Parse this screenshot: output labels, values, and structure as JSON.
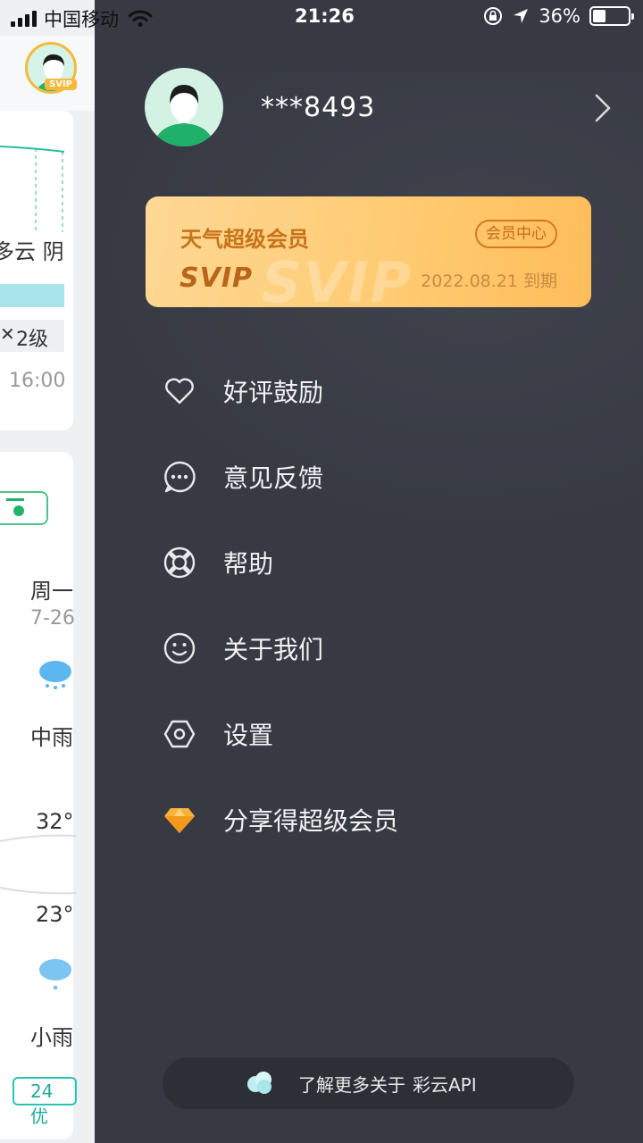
{
  "status_bar": {
    "carrier": "中国移动",
    "time": "21:26",
    "battery": "36%",
    "battery_level": 0.36
  },
  "background_app": {
    "weather_text": "多云 阴",
    "wind": "2级",
    "time_label": "16:00",
    "day_label": "周一",
    "date_label": "7-26",
    "condition_1": "中雨",
    "temp_high": "32°",
    "temp_low": "23°",
    "condition_2": "小雨",
    "aqi": "24 优",
    "svip_tag": "SVIP"
  },
  "drawer": {
    "username": "***8493",
    "vip_card": {
      "title": "天气超级会员",
      "logo_text": "SVIP",
      "center_button": "会员中心",
      "expire": "2022.08.21 到期"
    },
    "menu": [
      {
        "label": "好评鼓励",
        "icon": "heart-icon"
      },
      {
        "label": "意见反馈",
        "icon": "feedback-icon"
      },
      {
        "label": "帮助",
        "icon": "lifebuoy-icon"
      },
      {
        "label": "关于我们",
        "icon": "smiley-icon"
      },
      {
        "label": "设置",
        "icon": "settings-icon"
      },
      {
        "label": "分享得超级会员",
        "icon": "diamond-icon"
      }
    ],
    "footer": {
      "prefix": "了解更多关于",
      "brand": "彩云API"
    }
  },
  "colors": {
    "drawer_bg": "#373a43",
    "vip_gold": "#ffcb73",
    "vip_text": "#c7731a",
    "accent_green": "#22b36b"
  }
}
